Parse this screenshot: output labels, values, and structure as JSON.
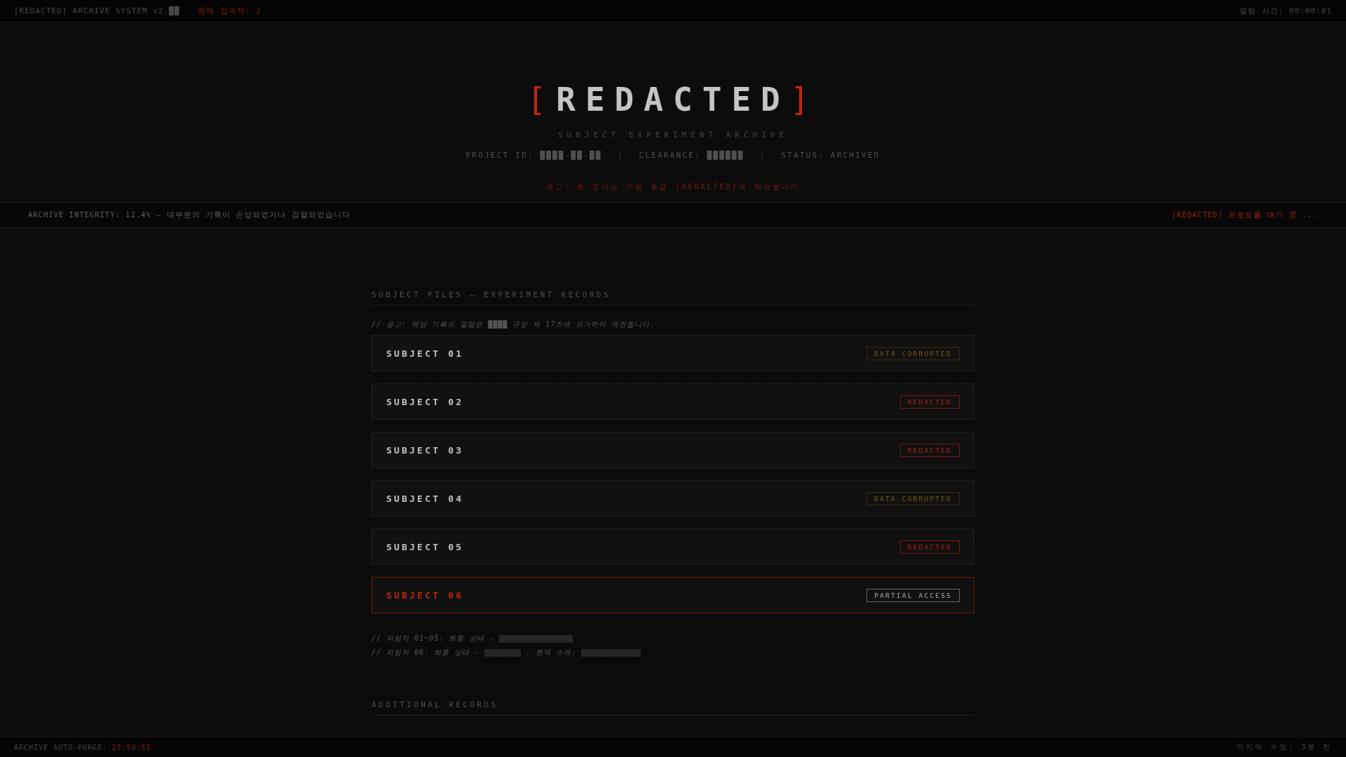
{
  "top_bar": {
    "system_name": "[REDACTED] ARCHIVE SYSTEM v2.██",
    "users_online": "현재 접속자: 2",
    "view_time": "열람 시간: 00:00:01"
  },
  "header": {
    "bracket_left": "[",
    "title": "REDACTED",
    "bracket_right": "]",
    "subtitle": "SUBJECT EXPERIMENT ARCHIVE",
    "meta": [
      {
        "kind": "field",
        "text": "PROJECT ID: ████-██-██"
      },
      {
        "kind": "separator",
        "text": "|"
      },
      {
        "kind": "field",
        "text": "CLEARANCE: ██████"
      },
      {
        "kind": "separator",
        "text": "|"
      },
      {
        "kind": "field",
        "text": "STATUS: ARCHIVED"
      }
    ],
    "warning": "경고: 본 문서는 기밀 등급 [REDACTED]에 해당합니다"
  },
  "integrity_bar": {
    "status": "ARCHIVE INTEGRITY: 12.4% — 대부분의 기록이 손상되었거나 검열되었습니다",
    "protocol": "[REDACTED] 프로토콜 대기 중 ..."
  },
  "subject_files": {
    "heading": "SUBJECT FILES — EXPERIMENT RECORDS",
    "notice": "// 경고: 해당 기록의 열람은 ████ 규정 제 17조에 의거하여 제한됩니다.",
    "items": [
      {
        "name": "SUBJECT 01",
        "status": "DATA CORRUPTED",
        "kind": "corrupted",
        "selected": false
      },
      {
        "name": "SUBJECT 02",
        "status": "REDACTED",
        "kind": "redacted",
        "selected": false
      },
      {
        "name": "SUBJECT 03",
        "status": "REDACTED",
        "kind": "redacted",
        "selected": false
      },
      {
        "name": "SUBJECT 04",
        "status": "DATA CORRUPTED",
        "kind": "corrupted",
        "selected": false
      },
      {
        "name": "SUBJECT 05",
        "status": "REDACTED",
        "kind": "redacted",
        "selected": false
      },
      {
        "name": "SUBJECT 06",
        "status": "PARTIAL ACCESS",
        "kind": "partial",
        "selected": true
      }
    ],
    "notes": [
      [
        {
          "kind": "text",
          "text": "// 피험자 01~05: 최종 상태 —"
        },
        {
          "kind": "redaction"
        }
      ],
      [
        {
          "kind": "text",
          "text": "// 피험자 06: 최종 상태 —"
        },
        {
          "kind": "redaction"
        },
        {
          "kind": "text",
          "text": ". 현재 소재:"
        },
        {
          "kind": "redaction"
        }
      ]
    ]
  },
  "additional_records": {
    "heading": "ADDITIONAL RECORDS"
  },
  "bottom_bar": {
    "purge_label": "ARCHIVE AUTO-PURGE:",
    "purge_time": "23:59:58",
    "last_modified": "마지막 수정: 3분 전"
  }
}
